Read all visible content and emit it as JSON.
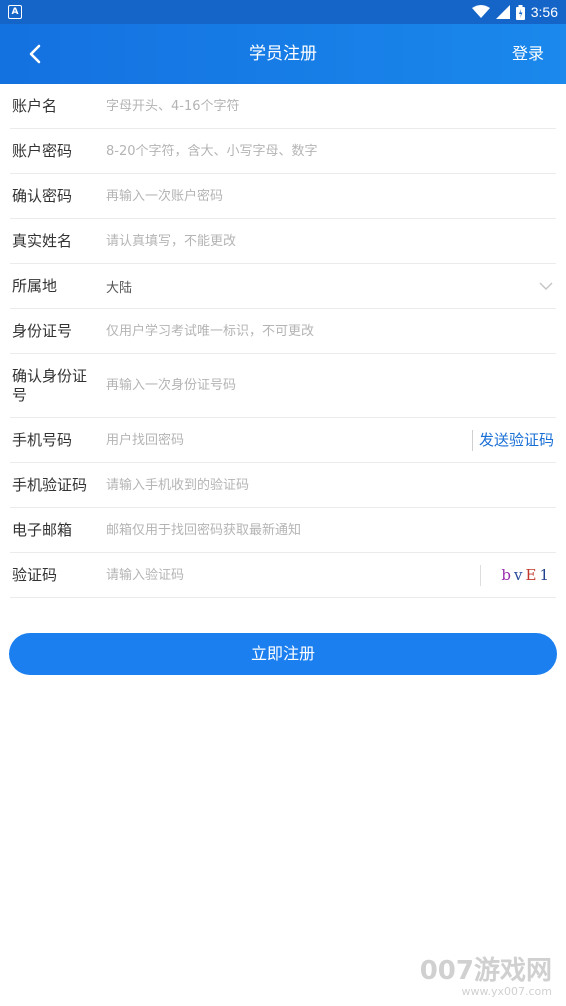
{
  "status_bar": {
    "time": "3:56",
    "app_badge": "A",
    "icons": [
      "wifi-icon",
      "signal-icon",
      "battery-icon"
    ]
  },
  "header": {
    "title": "学员注册",
    "right_link": "登录",
    "back_icon": "chevron-left-icon"
  },
  "form": {
    "account_name": {
      "label": "账户名",
      "placeholder": "字母开头、4-16个字符"
    },
    "password": {
      "label": "账户密码",
      "placeholder": "8-20个字符，含大、小写字母、数字"
    },
    "confirm_password": {
      "label": "确认密码",
      "placeholder": "再输入一次账户密码"
    },
    "real_name": {
      "label": "真实姓名",
      "placeholder": "请认真填写，不能更改"
    },
    "region": {
      "label": "所属地",
      "value": "大陆"
    },
    "id_number": {
      "label": "身份证号",
      "placeholder": "仅用户学习考试唯一标识，不可更改"
    },
    "confirm_id": {
      "label": "确认身份证号",
      "placeholder": "再输入一次身份证号码"
    },
    "phone": {
      "label": "手机号码",
      "placeholder": "用户找回密码",
      "button": "发送验证码"
    },
    "sms_code": {
      "label": "手机验证码",
      "placeholder": "请输入手机收到的验证码"
    },
    "email": {
      "label": "电子邮箱",
      "placeholder": "邮箱仅用于找回密码获取最新通知"
    },
    "captcha": {
      "label": "验证码",
      "placeholder": "请输入验证码",
      "chars": [
        "b",
        "v",
        "E",
        "1"
      ],
      "char_colors": [
        "#9b2fae",
        "#2a4c9a",
        "#c0392b",
        "#1f3f8f"
      ]
    }
  },
  "submit_label": "立即注册",
  "watermark": {
    "main": "007游戏网",
    "sub": "www.yx007.com"
  },
  "colors": {
    "primary": "#1b7ff0",
    "header": "#1471e0",
    "link": "#1a6fd6"
  }
}
